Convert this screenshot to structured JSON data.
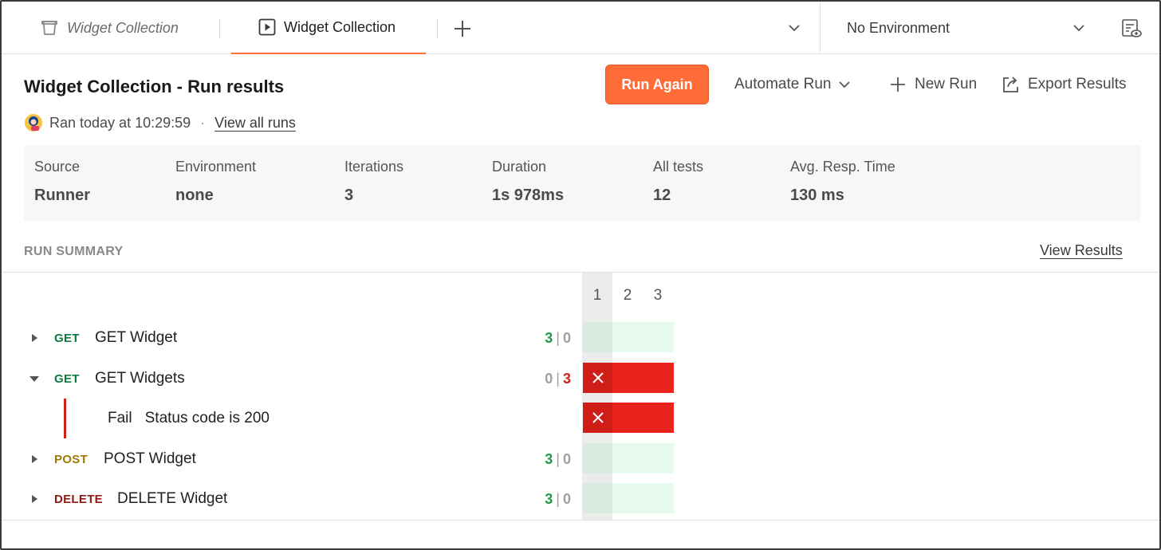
{
  "tabs": [
    {
      "label": "Widget Collection",
      "icon": "collection-icon",
      "style": "preview"
    },
    {
      "label": "Widget Collection",
      "icon": "runner-play-icon",
      "active": true
    }
  ],
  "environment": {
    "selected": "No Environment"
  },
  "header": {
    "title": "Widget Collection - Run results",
    "run_again": "Run Again",
    "automate_run": "Automate Run",
    "new_run": "New Run",
    "export_results": "Export Results",
    "ran_at": "Ran today at 10:29:59",
    "separator": "·",
    "view_all_runs": "View all runs"
  },
  "stats": [
    {
      "label": "Source",
      "value": "Runner"
    },
    {
      "label": "Environment",
      "value": "none"
    },
    {
      "label": "Iterations",
      "value": "3"
    },
    {
      "label": "Duration",
      "value": "1s 978ms"
    },
    {
      "label": "All tests",
      "value": "12"
    },
    {
      "label": "Avg. Resp. Time",
      "value": "130 ms"
    }
  ],
  "summary": {
    "label": "RUN SUMMARY",
    "view_results": "View Results",
    "iterations": [
      "1",
      "2",
      "3"
    ],
    "selected_iteration": "1"
  },
  "requests": [
    {
      "method": "GET",
      "name": "GET Widget",
      "passed": "3",
      "failed": "0",
      "expanded": false,
      "status": "pass"
    },
    {
      "method": "GET",
      "name": "GET Widgets",
      "passed": "0",
      "failed": "3",
      "expanded": true,
      "status": "fail",
      "tests": [
        {
          "result": "Fail",
          "name": "Status code is 200"
        }
      ]
    },
    {
      "method": "POST",
      "name": "POST Widget",
      "passed": "3",
      "failed": "0",
      "expanded": false,
      "status": "pass"
    },
    {
      "method": "DELETE",
      "name": "DELETE Widget",
      "passed": "3",
      "failed": "0",
      "expanded": false,
      "status": "pass"
    }
  ],
  "colors": {
    "accent": "#ff6c37",
    "pass": "#1f9a48",
    "fail": "#d0201a",
    "get": "#0b7a3e",
    "post": "#a07800",
    "delete": "#8e1a10"
  }
}
